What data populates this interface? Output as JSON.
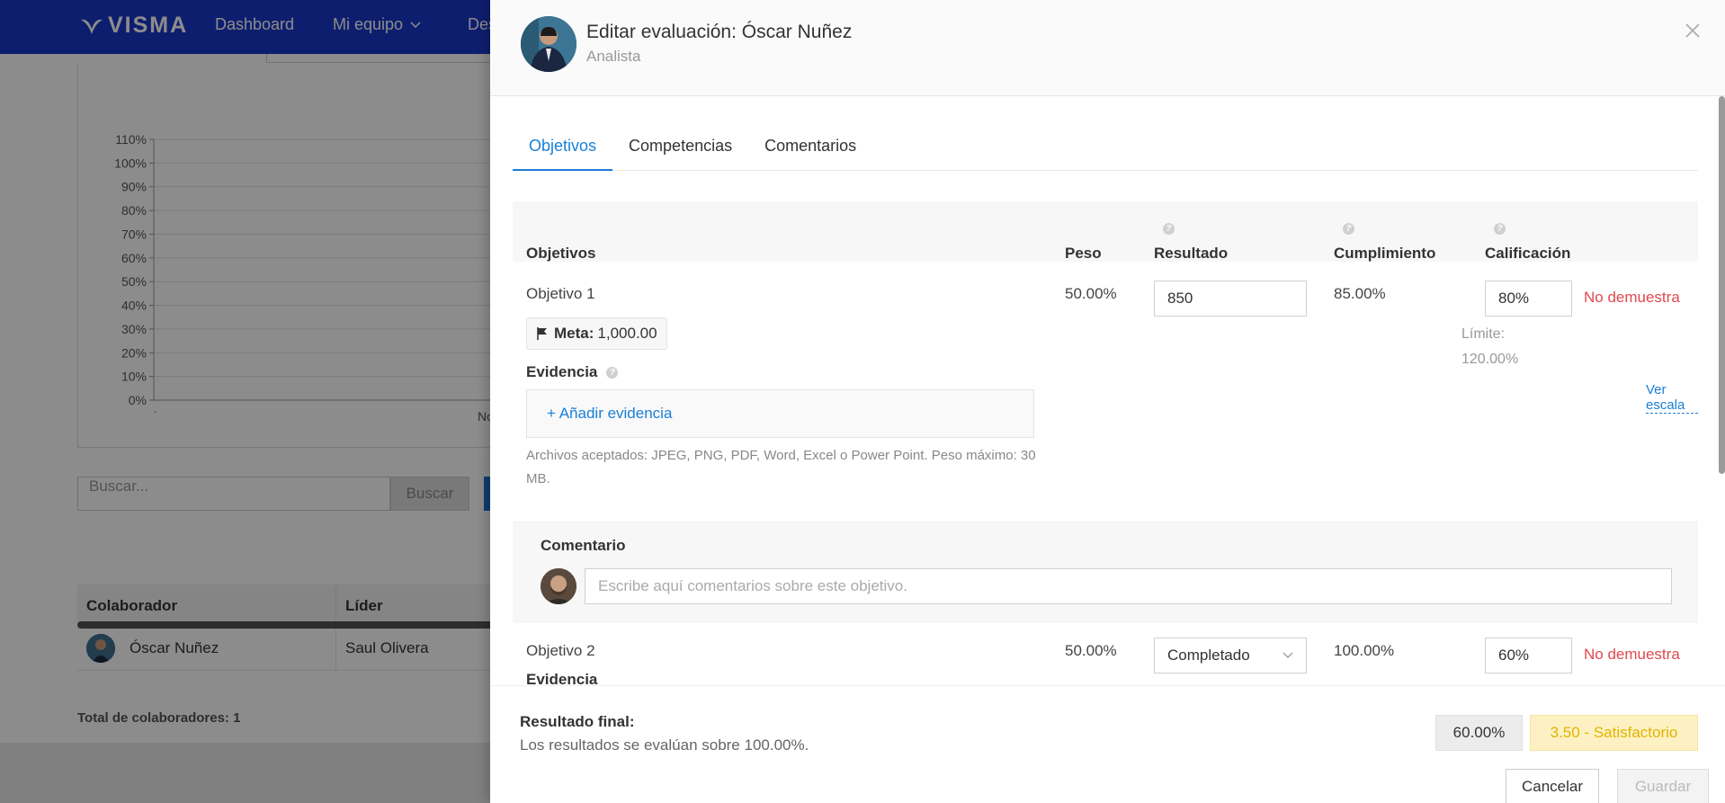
{
  "header": {
    "logo": "VISMA",
    "nav": [
      {
        "label": "Dashboard"
      },
      {
        "label": "Mi equipo"
      },
      {
        "label": "Des"
      }
    ]
  },
  "background": {
    "chart_data": {
      "type": "bar",
      "title": "",
      "xlabel": "",
      "ylabel": "",
      "ylim": [
        0,
        110
      ],
      "y_ticks": [
        "110%",
        "100%",
        "90%",
        "80%",
        "70%",
        "60%",
        "50%",
        "40%",
        "30%",
        "20%",
        "10%",
        "0%"
      ],
      "categories": [
        "No"
      ],
      "values": [],
      "grid": true
    },
    "search": {
      "placeholder": "Buscar...",
      "button": "Buscar"
    },
    "table": {
      "columns": [
        "Colaborador",
        "Líder"
      ],
      "rows": [
        {
          "colaborador": "Óscar Nuñez",
          "lider": "Saul Olivera"
        }
      ]
    },
    "total": "Total de colaboradores: 1"
  },
  "drawer": {
    "title": "Editar evaluación: Óscar Nuñez",
    "subtitle": "Analista",
    "tabs": [
      {
        "label": "Objetivos",
        "active": true
      },
      {
        "label": "Competencias",
        "active": false
      },
      {
        "label": "Comentarios",
        "active": false
      }
    ],
    "columns": {
      "objetivos": "Objetivos",
      "peso": "Peso",
      "resultado": "Resultado",
      "cumplimiento": "Cumplimiento",
      "calificacion": "Calificación"
    },
    "objective1": {
      "name": "Objetivo 1",
      "meta_label": "Meta:",
      "meta_value": "1,000.00",
      "evidence_label": "Evidencia",
      "add_evidence": "+ Añadir evidencia",
      "files_note": "Archivos aceptados: JPEG, PNG, PDF, Word, Excel o Power Point. Peso máximo: 30 MB.",
      "peso": "50.00%",
      "resultado": "850",
      "cumplimiento": "85.00%",
      "calificacion": "80%",
      "status": "No demuestra",
      "limit_label": "Límite:",
      "limit_value": "120.00%",
      "ver_escala": "Ver escala"
    },
    "comment": {
      "label": "Comentario",
      "placeholder": "Escribe aquí comentarios sobre este objetivo."
    },
    "objective2": {
      "name": "Objetivo 2",
      "peso": "50.00%",
      "resultado": "Completado",
      "cumplimiento": "100.00%",
      "calificacion": "60%",
      "status": "No demuestra",
      "evidence_label": "Evidencia"
    },
    "footer": {
      "final_label": "Resultado final:",
      "final_sub": "Los resultados se evalúan sobre 100.00%.",
      "percentage": "60.00%",
      "score": "3.50 - Satisfactorio",
      "cancel": "Cancelar",
      "save": "Guardar"
    }
  }
}
